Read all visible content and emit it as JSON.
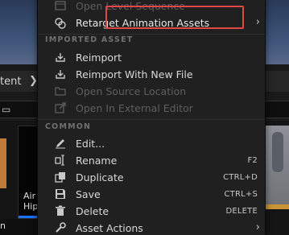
{
  "background": {
    "breadcrumb_fragment": "tent",
    "breadcrumb_sep": "❯",
    "search_glyph": "▭",
    "left_thumb_caption_1": "Air",
    "left_thumb_caption_2": "Hip",
    "left_thumb_caption_3": "n"
  },
  "menu": {
    "items_top": [
      {
        "label": "Open Level Sequence",
        "icon": "film-icon",
        "disabled": true
      },
      {
        "label": "Retarget Animation Assets",
        "icon": "retarget-icon",
        "submenu_arrow": "›",
        "highlighted": true
      }
    ],
    "section_imported": "IMPORTED ASSET",
    "items_imported": [
      {
        "label": "Reimport",
        "icon": "reimport-icon",
        "disabled": false
      },
      {
        "label": "Reimport With New File",
        "icon": "reimport-icon",
        "disabled": false
      },
      {
        "label": "Open Source Location",
        "icon": "folder-icon",
        "disabled": true
      },
      {
        "label": "Open In External Editor",
        "icon": "external-icon",
        "disabled": true
      }
    ],
    "section_common": "COMMON",
    "items_common": [
      {
        "label": "Edit...",
        "icon": "pencil-icon",
        "shortcut": ""
      },
      {
        "label": "Rename",
        "icon": "rename-icon",
        "shortcut": "F2"
      },
      {
        "label": "Duplicate",
        "icon": "duplicate-icon",
        "shortcut": "CTRL+D"
      },
      {
        "label": "Save",
        "icon": "save-icon",
        "shortcut": "CTRL+S"
      },
      {
        "label": "Delete",
        "icon": "trash-icon",
        "shortcut": "DELETE"
      },
      {
        "label": "Asset Actions",
        "icon": "wrench-icon",
        "shortcut": "",
        "submenu_arrow": "›"
      }
    ]
  },
  "colors": {
    "menu_bg": "#202020",
    "highlight_outline": "#e04848",
    "disabled_text": "#5e5e5e",
    "accent_blue": "#1a73ff"
  }
}
